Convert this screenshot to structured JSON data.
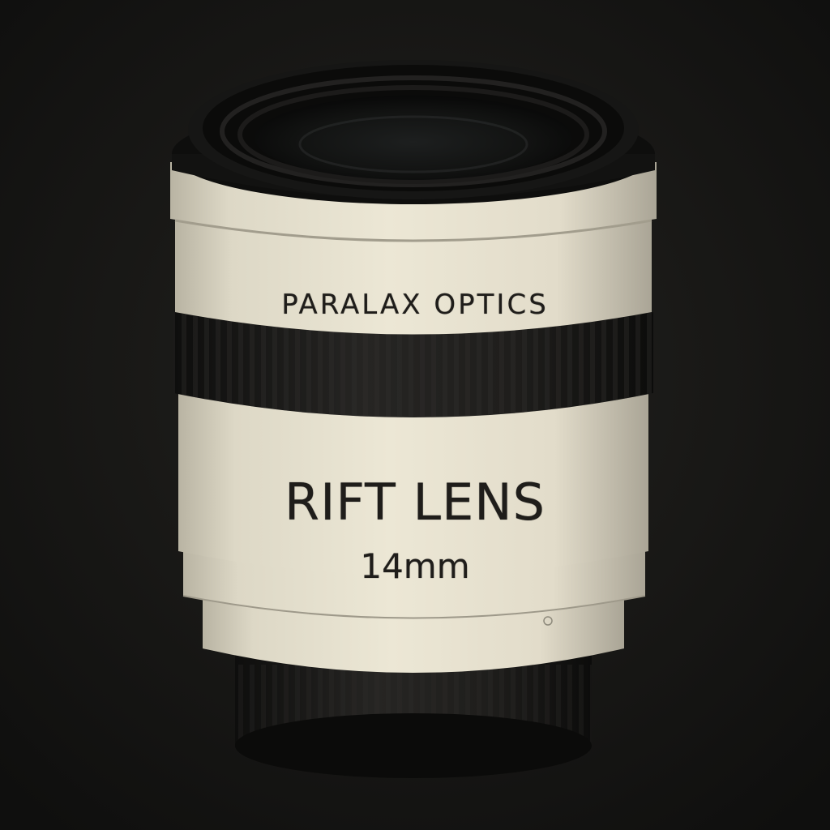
{
  "lens": {
    "brand": "PARALAX OPTICS",
    "model": "RIFT LENS",
    "focal_length": "14mm"
  },
  "colors": {
    "background": "#161513",
    "barrel": "#e7e1cf",
    "rubber": "#1c1b19",
    "text": "#1f1d1a"
  }
}
